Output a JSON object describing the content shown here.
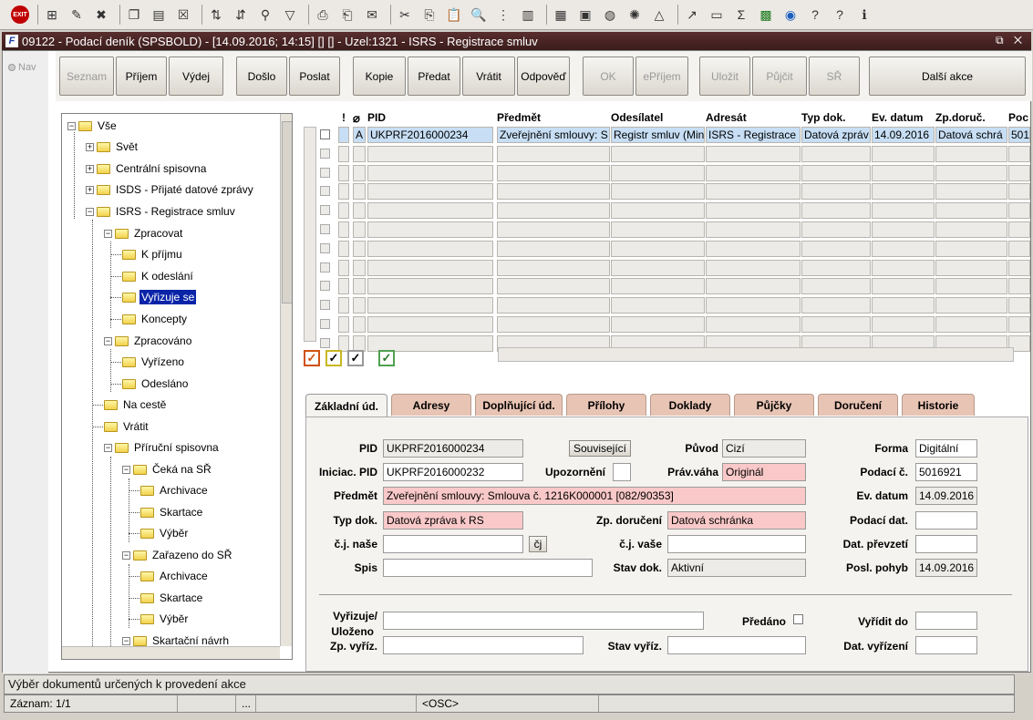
{
  "window": {
    "title": "09122 - Podací deník (SPSBOLD) - [14.09.2016; 14:15] [] [] - Uzel:1321 - ISRS - Registrace smluv",
    "controls": "⧉ ✕"
  },
  "nav": {
    "label": "Nav"
  },
  "buttons": {
    "seznam": "Seznam",
    "prijem": "Příjem",
    "vydej": "Výdej",
    "doslo": "Došlo",
    "poslat": "Poslat",
    "kopie": "Kopie",
    "predat": "Předat",
    "vratit": "Vrátit",
    "odpoved": "Odpověď",
    "ok": "OK",
    "eprijem": "ePříjem",
    "ulozit": "Uložit",
    "pujcit": "Půjčit",
    "sr": "SŘ",
    "dalsi": "Další akce"
  },
  "tree": {
    "root": "Vše",
    "svet": "Svět",
    "centralni": "Centrální spisovna",
    "isds": "ISDS - Přijaté datové zprávy",
    "isrs": "ISRS - Registrace smluv",
    "zpracovat": "Zpracovat",
    "k_prijmu": "K příjmu",
    "k_odeslani": "K odeslání",
    "vyrizuje": "Vyřizuje se",
    "koncepty": "Koncepty",
    "zpracovano": "Zpracováno",
    "vyrizeno": "Vyřízeno",
    "odeslano": "Odesláno",
    "na_ceste": "Na cestě",
    "vratit": "Vrátit",
    "prirucni": "Příruční spisovna",
    "ceka": "Čeká na SŘ",
    "archivace1": "Archivace",
    "skartace1": "Skartace",
    "vyber1": "Výběr",
    "zarazeno": "Zařazeno do SŘ",
    "archivace2": "Archivace",
    "skartace2": "Skartace",
    "vyber2": "Výběr",
    "skartacni": "Skartační návrh"
  },
  "grid": {
    "headers": {
      "excl": "!",
      "att": "",
      "pid": "PID",
      "predmet": "Předmět",
      "odesilatel": "Odesílatel",
      "adresat": "Adresát",
      "typ": "Typ dok.",
      "ev": "Ev. datum",
      "zp": "Zp.doruč.",
      "poc": "Poc"
    },
    "row": {
      "a": "A",
      "pid": "UKPRF2016000234",
      "predmet": "Zveřejnění smlouvy: S",
      "odesilatel": "Registr smluv (Min",
      "adresat": "ISRS - Registrace",
      "typ": "Datová zpráv",
      "ev": "14.09.2016",
      "zp": "Datová schrá",
      "poc": "501"
    }
  },
  "tabs": [
    "Základní úd.",
    "Adresy",
    "Doplňující úd.",
    "Přílohy",
    "Doklady",
    "Půjčky",
    "Doručení",
    "Historie"
  ],
  "form": {
    "pid_l": "PID",
    "pid": "UKPRF2016000234",
    "souvisejici": "Související",
    "puvod_l": "Původ",
    "puvod": "Cizí",
    "forma_l": "Forma",
    "forma": "Digitální",
    "iniciac_l": "Iniciac. PID",
    "iniciac": "UKPRF2016000232",
    "upoz_l": "Upozornění",
    "prav_l": "Práv.váha",
    "prav": "Originál",
    "podaci_l": "Podací č.",
    "podaci": "5016921",
    "predmet_l": "Předmět",
    "predmet": "Zveřejnění smlouvy: Smlouva č. 1216K000001 [082/90353]",
    "evdatum_l": "Ev. datum",
    "evdatum": "14.09.2016",
    "typ_l": "Typ dok.",
    "typ": "Datová zpráva k RS",
    "zpdor_l": "Zp. doručení",
    "zpdor": "Datová schránka",
    "podacidat_l": "Podací dat.",
    "cjnase_l": "č.j. naše",
    "cj_btn": "čj",
    "cjvase_l": "č.j. vaše",
    "datprevz_l": "Dat. převzetí",
    "spis_l": "Spis",
    "stav_l": "Stav dok.",
    "stav": "Aktivní",
    "poslpohyb_l": "Posl. pohyb",
    "poslpohyb": "14.09.2016",
    "vyrizuje_l": "Vyřizuje/",
    "ulozeno_l": "Uloženo",
    "predano_l": "Předáno",
    "vyriditdo_l": "Vyřídit do",
    "zpvyriz_l": "Zp. vyříz.",
    "stavvyriz_l": "Stav vyříz.",
    "datvyriz_l": "Dat. vyřízení"
  },
  "status": {
    "msg": "Výběr dokumentů určených k provedení akce",
    "zaznam": "Záznam: 1/1",
    "dots": "...",
    "osc": "<OSC>"
  }
}
